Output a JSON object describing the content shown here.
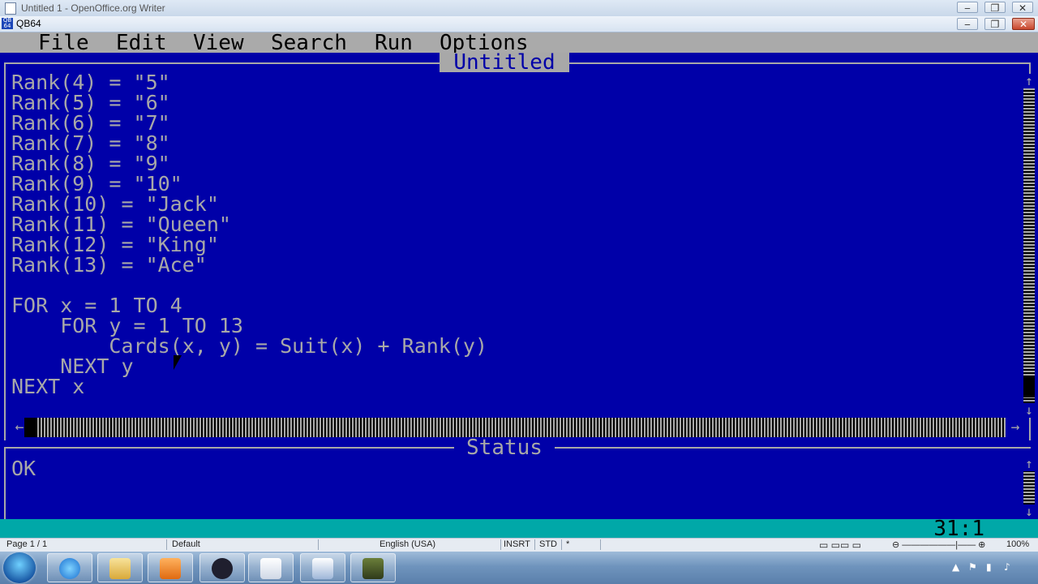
{
  "outer_window": {
    "title": "Untitled 1 - OpenOffice.org Writer"
  },
  "window": {
    "title": "QB64",
    "minimize": "▭",
    "restore": "❐",
    "close": "✕"
  },
  "menu": [
    "File",
    "Edit",
    "View",
    "Search",
    "Run",
    "Options"
  ],
  "editor": {
    "title": "Untitled",
    "lines": [
      "Rank(4) = \"5\"",
      "Rank(5) = \"6\"",
      "Rank(6) = \"7\"",
      "Rank(7) = \"8\"",
      "Rank(8) = \"9\"",
      "Rank(9) = \"10\"",
      "Rank(10) = \"Jack\"",
      "Rank(11) = \"Queen\"",
      "Rank(12) = \"King\"",
      "Rank(13) = \"Ace\"",
      "",
      "FOR x = 1 TO 4",
      "    FOR y = 1 TO 13",
      "        Cards(x, y) = Suit(x) + Rank(y)",
      "    NEXT y",
      "NEXT x"
    ],
    "scroll_up": "↑",
    "scroll_down": "↓",
    "scroll_left": "←",
    "scroll_right": "→"
  },
  "status": {
    "title": "Status",
    "message": "OK"
  },
  "cursor_position": "31:1",
  "writer_statusbar": {
    "page": "Page 1 / 1",
    "style": "Default",
    "language": "English (USA)",
    "insert_mode": "INSRT",
    "selection_mode": "STD",
    "modified": "*",
    "zoom": "100%"
  },
  "colors": {
    "editor_bg": "#0000a8",
    "editor_text": "#a8a8a8",
    "menu_bg": "#aaaaaa",
    "status_bar": "#00a8a8"
  }
}
